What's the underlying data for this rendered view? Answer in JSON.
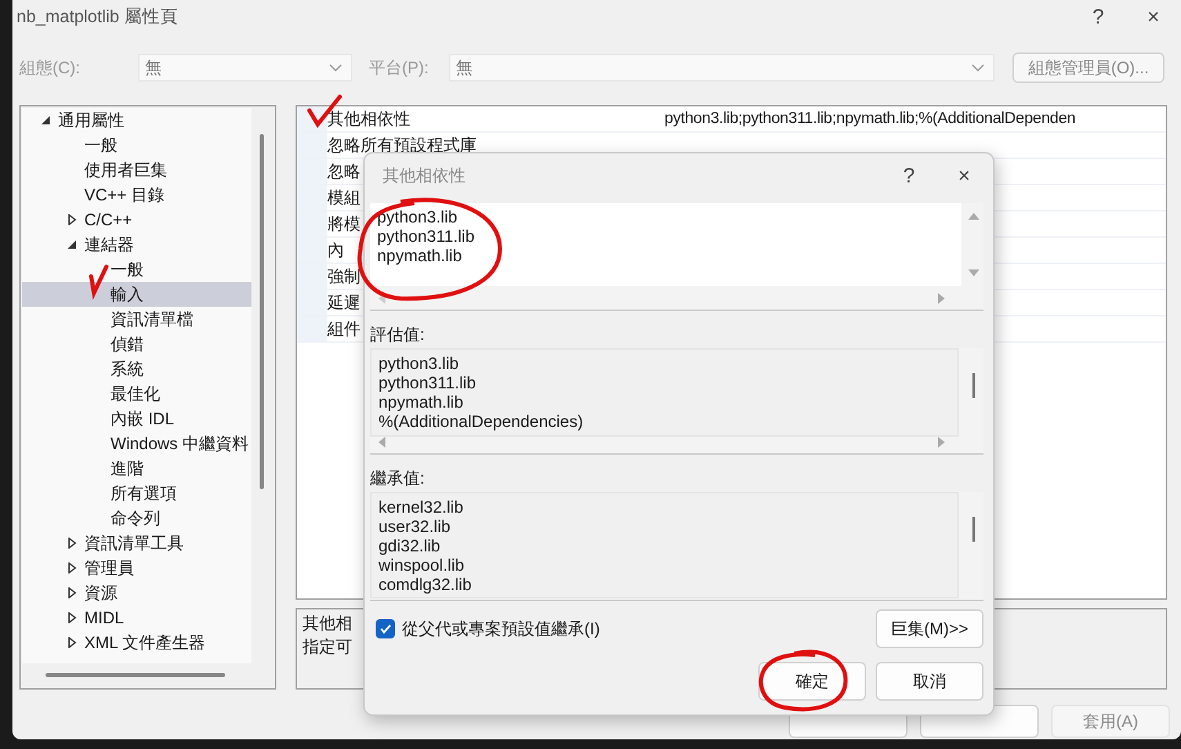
{
  "window": {
    "title": "nb_matplotlib 屬性頁",
    "help": "?",
    "close": "×"
  },
  "config": {
    "label": "組態(C):",
    "value": "無"
  },
  "platform": {
    "label": "平台(P):",
    "value": "無"
  },
  "config_manager_button": "組態管理員(O)...",
  "tree": [
    {
      "label": "通用屬性",
      "expanded": true,
      "selected": false,
      "children": [
        {
          "label": "一般",
          "selected": false
        },
        {
          "label": "使用者巨集",
          "selected": false
        },
        {
          "label": "VC++ 目錄",
          "selected": false
        },
        {
          "label": "C/C++",
          "expanded": false,
          "selected": false
        },
        {
          "label": "連結器",
          "expanded": true,
          "selected": false,
          "children": [
            {
              "label": "一般",
              "selected": false
            },
            {
              "label": "輸入",
              "selected": true
            },
            {
              "label": "資訊清單檔",
              "selected": false
            },
            {
              "label": "偵錯",
              "selected": false
            },
            {
              "label": "系統",
              "selected": false
            },
            {
              "label": "最佳化",
              "selected": false
            },
            {
              "label": "內嵌 IDL",
              "selected": false
            },
            {
              "label": "Windows 中繼資料",
              "selected": false
            },
            {
              "label": "進階",
              "selected": false
            },
            {
              "label": "所有選項",
              "selected": false
            },
            {
              "label": "命令列",
              "selected": false
            }
          ]
        },
        {
          "label": "資訊清單工具",
          "expanded": false,
          "selected": false
        },
        {
          "label": "管理員",
          "expanded": false,
          "selected": false
        },
        {
          "label": "資源",
          "expanded": false,
          "selected": false
        },
        {
          "label": "MIDL",
          "expanded": false,
          "selected": false
        },
        {
          "label": "XML 文件產生器",
          "expanded": false,
          "selected": false
        }
      ]
    }
  ],
  "properties": [
    {
      "name": "其他相依性",
      "value": "python3.lib;python311.lib;npymath.lib;%(AdditionalDependen"
    },
    {
      "name": "忽略所有預設程式庫"
    },
    {
      "name": "忽略"
    },
    {
      "name": "模組"
    },
    {
      "name": "將模"
    },
    {
      "name": "內"
    },
    {
      "name": "強制"
    },
    {
      "name": "延遲"
    },
    {
      "name": "組件"
    }
  ],
  "description": {
    "title": "其他相",
    "text": "指定可"
  },
  "apply_button": {
    "label": "套用(A)",
    "disabled": true
  },
  "dialog": {
    "title": "其他相依性",
    "help": "?",
    "close": "×",
    "edit_lines": [
      "python3.lib",
      "python311.lib",
      "npymath.lib"
    ],
    "evaluated_label": "評估值:",
    "evaluated_lines": [
      "python3.lib",
      "python311.lib",
      "npymath.lib",
      "%(AdditionalDependencies)"
    ],
    "inherited_label": "繼承值:",
    "inherited_lines": [
      "kernel32.lib",
      "user32.lib",
      "gdi32.lib",
      "winspool.lib",
      "comdlg32.lib"
    ],
    "inherit_checkbox": {
      "label": "從父代或專案預設值繼承(I)",
      "checked": true
    },
    "macros_button": "巨集(M)>>",
    "ok_button": "確定",
    "cancel_button": "取消"
  }
}
